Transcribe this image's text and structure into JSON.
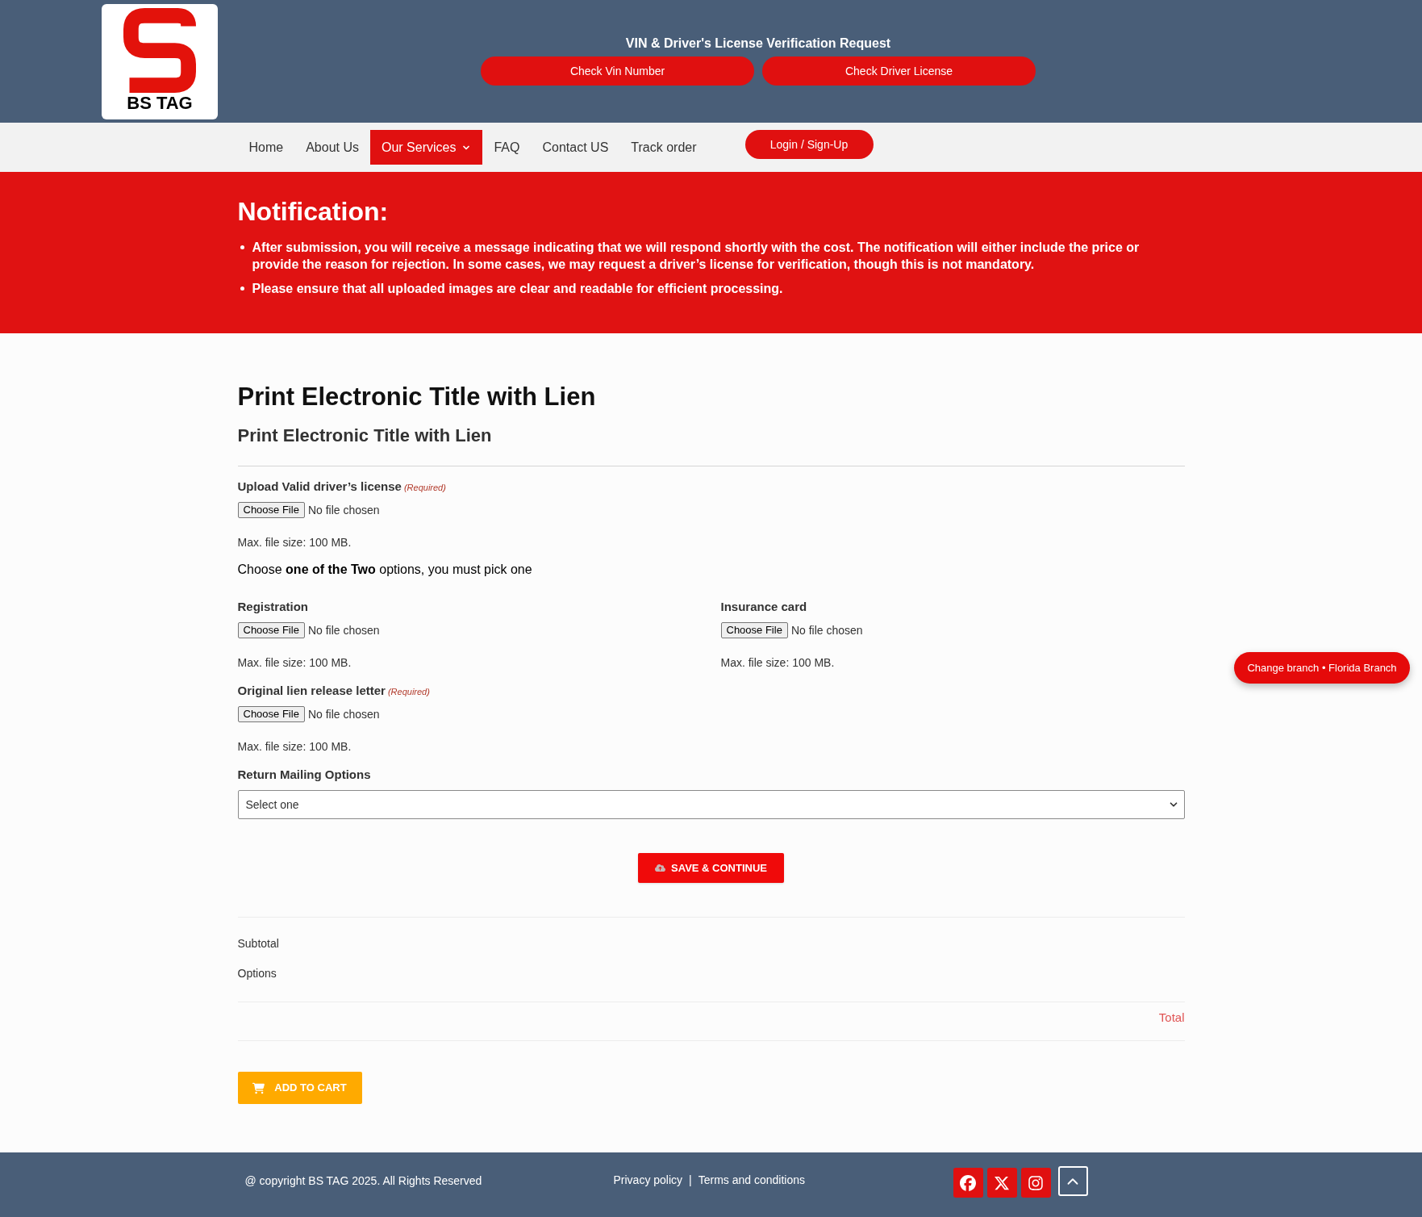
{
  "header": {
    "logo_text": "BS TAG",
    "title": "VIN & Driver's License Verification Request",
    "buttons": [
      "Check Vin Number",
      "Check Driver License"
    ]
  },
  "nav": {
    "items": [
      {
        "label": "Home",
        "selected": false,
        "has_dropdown": false
      },
      {
        "label": "About Us",
        "selected": false,
        "has_dropdown": false
      },
      {
        "label": "Our Services",
        "selected": true,
        "has_dropdown": true
      },
      {
        "label": "FAQ",
        "selected": false,
        "has_dropdown": false
      },
      {
        "label": "Contact US",
        "selected": false,
        "has_dropdown": false
      },
      {
        "label": "Track order",
        "selected": false,
        "has_dropdown": false
      }
    ],
    "login_button": "Login / Sign-Up"
  },
  "notification": {
    "title": "Notification:",
    "items": [
      "After submission, you will receive a message indicating that we will respond shortly with the cost. The notification will either include the price or provide the reason for rejection. In some cases, we may request a driver’s license for verification, though this is not mandatory.",
      "Please ensure that all uploaded images are clear and readable for efficient processing."
    ]
  },
  "form": {
    "title": "Print Electronic Title with Lien",
    "subtitle": "Print Electronic Title with Lien",
    "fields": [
      {
        "kind": "file",
        "label": "Upload Valid driver’s license",
        "required_note": "(Required)",
        "button": "Choose File",
        "status": "No file chosen",
        "hint": "Max. file size: 100 MB."
      },
      {
        "kind": "instruction",
        "text": "Choose **one of the Two** options, you must pick one"
      },
      {
        "kind": "columns",
        "columns": [
          {
            "kind": "file",
            "label": "Registration",
            "button": "Choose File",
            "status": "No file chosen",
            "hint": "Max. file size: 100 MB."
          },
          {
            "kind": "file",
            "label": "Insurance card",
            "button": "Choose File",
            "status": "No file chosen",
            "hint": "Max. file size: 100 MB."
          }
        ]
      },
      {
        "kind": "file",
        "label": "Original lien release letter",
        "required_note": "(Required)",
        "button": "Choose File",
        "status": "No file chosen",
        "hint": "Max. file size: 100 MB."
      },
      {
        "kind": "select",
        "label": "Return Mailing Options",
        "placeholder": "Select one"
      }
    ],
    "save_button": "SAVE & CONTINUE"
  },
  "summary": {
    "subtotal": "Subtotal",
    "options": "Options",
    "total": "Total"
  },
  "cart_button": "ADD TO CART",
  "branch_button": "Change branch • Florida Branch",
  "footer": {
    "copyright": "@ copyright BS TAG 2025. All Rights Reserved",
    "links": [
      "Privacy policy",
      "Terms and conditions"
    ],
    "link_separator": "|"
  }
}
